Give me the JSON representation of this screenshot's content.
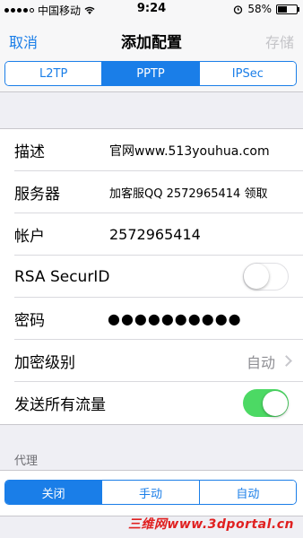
{
  "status_bar": {
    "carrier": "中国移动",
    "time": "9:24",
    "battery": "58%",
    "battery_level": 0.58
  },
  "nav": {
    "cancel": "取消",
    "title": "添加配置",
    "save": "存储"
  },
  "vpn_type": {
    "options": [
      "L2TP",
      "PPTP",
      "IPSec"
    ],
    "selected": "PPTP"
  },
  "fields": {
    "description": {
      "label": "描述",
      "value": "官网www.513youhua.com"
    },
    "server": {
      "label": "服务器",
      "value": "加客服QQ 2572965414 领取"
    },
    "account": {
      "label": "帐户",
      "value": "2572965414"
    },
    "rsa": {
      "label": "RSA SecurID",
      "enabled": false
    },
    "password": {
      "label": "密码",
      "value": "●●●●●●●●●●"
    },
    "encryption": {
      "label": "加密级别",
      "value": "自动"
    },
    "send_all": {
      "label": "发送所有流量",
      "enabled": true
    }
  },
  "proxy": {
    "header": "代理",
    "options": [
      "关闭",
      "手动",
      "自动"
    ],
    "selected": "关闭"
  },
  "watermark": "三维网www.3dportal.cn",
  "colors": {
    "accent": "#1a7ee8",
    "toggle_on": "#4cd964",
    "watermark": "#e02020"
  }
}
